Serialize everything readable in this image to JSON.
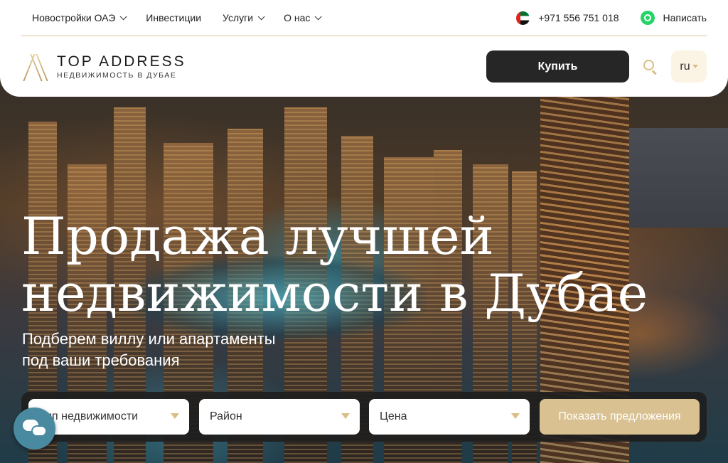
{
  "nav": {
    "items": [
      {
        "label": "Новостройки ОАЭ",
        "has_dropdown": true
      },
      {
        "label": "Инвестиции",
        "has_dropdown": false
      },
      {
        "label": "Услуги",
        "has_dropdown": true
      },
      {
        "label": "О нас",
        "has_dropdown": true
      }
    ],
    "phone": "+971 556 751 018",
    "write_label": "Написать"
  },
  "logo": {
    "main": "TOP ADDRESS",
    "sub": "НЕДВИЖИМОСТЬ В ДУБАЕ"
  },
  "header": {
    "buy_label": "Купить",
    "lang": "ru"
  },
  "hero": {
    "title_line1": "Продажа лучшей",
    "title_line2": "недвижимости в Дубае",
    "subtitle_line1": "Подберем виллу или апартаменты",
    "subtitle_line2": "под ваши требования"
  },
  "filter": {
    "type": "Тип недвижимости",
    "district": "Район",
    "price": "Цена",
    "submit": "Показать предложения"
  },
  "colors": {
    "accent": "#d9be86",
    "dark": "#262626"
  },
  "icons": {
    "flag": "uae-flag-icon",
    "whatsapp": "whatsapp-icon",
    "search": "search-icon",
    "chat": "chat-icon"
  }
}
